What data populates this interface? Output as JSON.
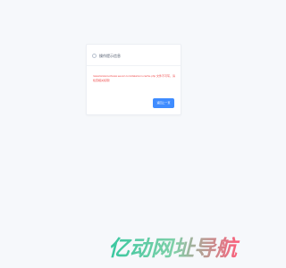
{
  "dialog": {
    "title": "操作提示信息",
    "icon": "info-circle-icon",
    "message": "/www/wwwroot/www.eeosz.com/data/com.cache.php 文件不可写，请检查相关权限！",
    "back_button_label": "返回上一页"
  },
  "watermark": {
    "text": "亿动网址导航"
  },
  "colors": {
    "background": "#f6f8fb",
    "error": "#ef4b4b",
    "button": "#3f8cff",
    "watermark_left": "#37c7a0",
    "watermark_right": "#ff5c7a"
  }
}
